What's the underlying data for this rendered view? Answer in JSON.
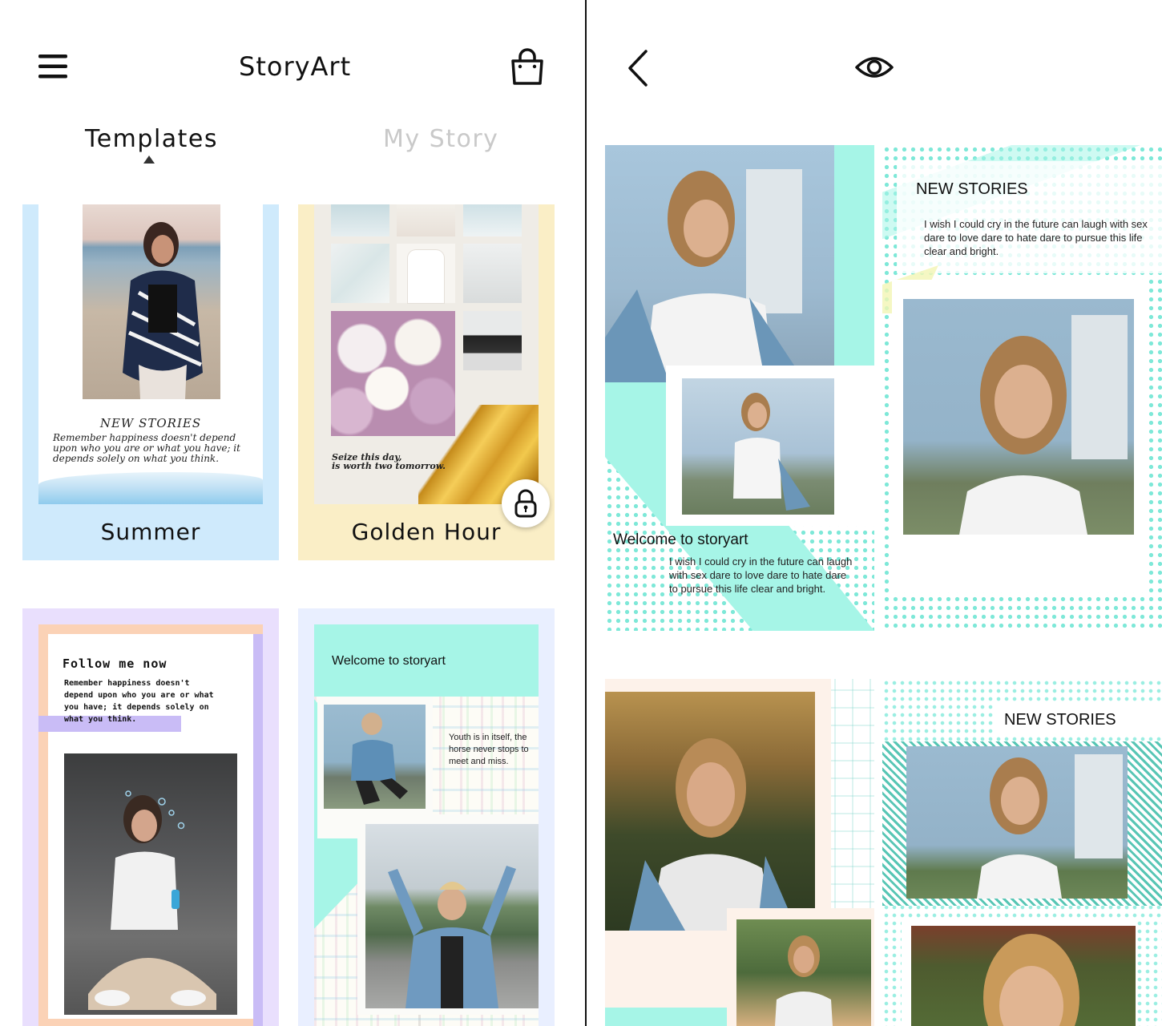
{
  "left_screen": {
    "app_title": "StoryArt",
    "tabs": [
      {
        "label": "Templates",
        "active": true
      },
      {
        "label": "My Story",
        "active": false
      }
    ],
    "templates": [
      {
        "label": "Summer",
        "heading": "NEW STORIES",
        "body": "Remember happiness doesn't depend upon who you are or what you have; it depends solely on what you think.",
        "locked": false
      },
      {
        "label": "Golden Hour",
        "caption_line1": "Seize this day,",
        "caption_line2": "is worth two tomorrow.",
        "locked": true
      },
      {
        "label": "",
        "heading": "Follow me now",
        "body_lines": [
          "Remember happiness doesn't",
          "depend upon who you are or what",
          "you have; it depends solely on",
          "what you think."
        ],
        "locked": false
      },
      {
        "label": "",
        "heading": "Welcome to storyart",
        "body_lines": [
          "Youth is in itself, the",
          "horse never stops to",
          "meet and miss."
        ],
        "locked": false
      }
    ]
  },
  "right_screen": {
    "preview_cards": [
      {
        "heading": "Welcome to storyart",
        "body_lines": [
          "I wish I could cry in the future can laugh",
          "with sex dare to love dare to hate dare",
          "to pursue this life clear and bright."
        ]
      },
      {
        "heading": "NEW STORIES",
        "body_lines": [
          "I wish I could cry in the future can laugh with sex",
          "dare to love dare to hate dare to pursue this life",
          "clear and bright."
        ]
      },
      {
        "heading": ""
      },
      {
        "heading": "NEW STORIES"
      }
    ]
  },
  "colors": {
    "summer_bg": "#cfeafc",
    "golden_bg": "#faeec6",
    "lavender_bg": "#e9dffd",
    "mint": "#a6f5e7",
    "divider": "#111111"
  },
  "icons": [
    "menu-icon",
    "shopping-bag-icon",
    "back-chevron-icon",
    "eye-icon",
    "lock-icon"
  ]
}
